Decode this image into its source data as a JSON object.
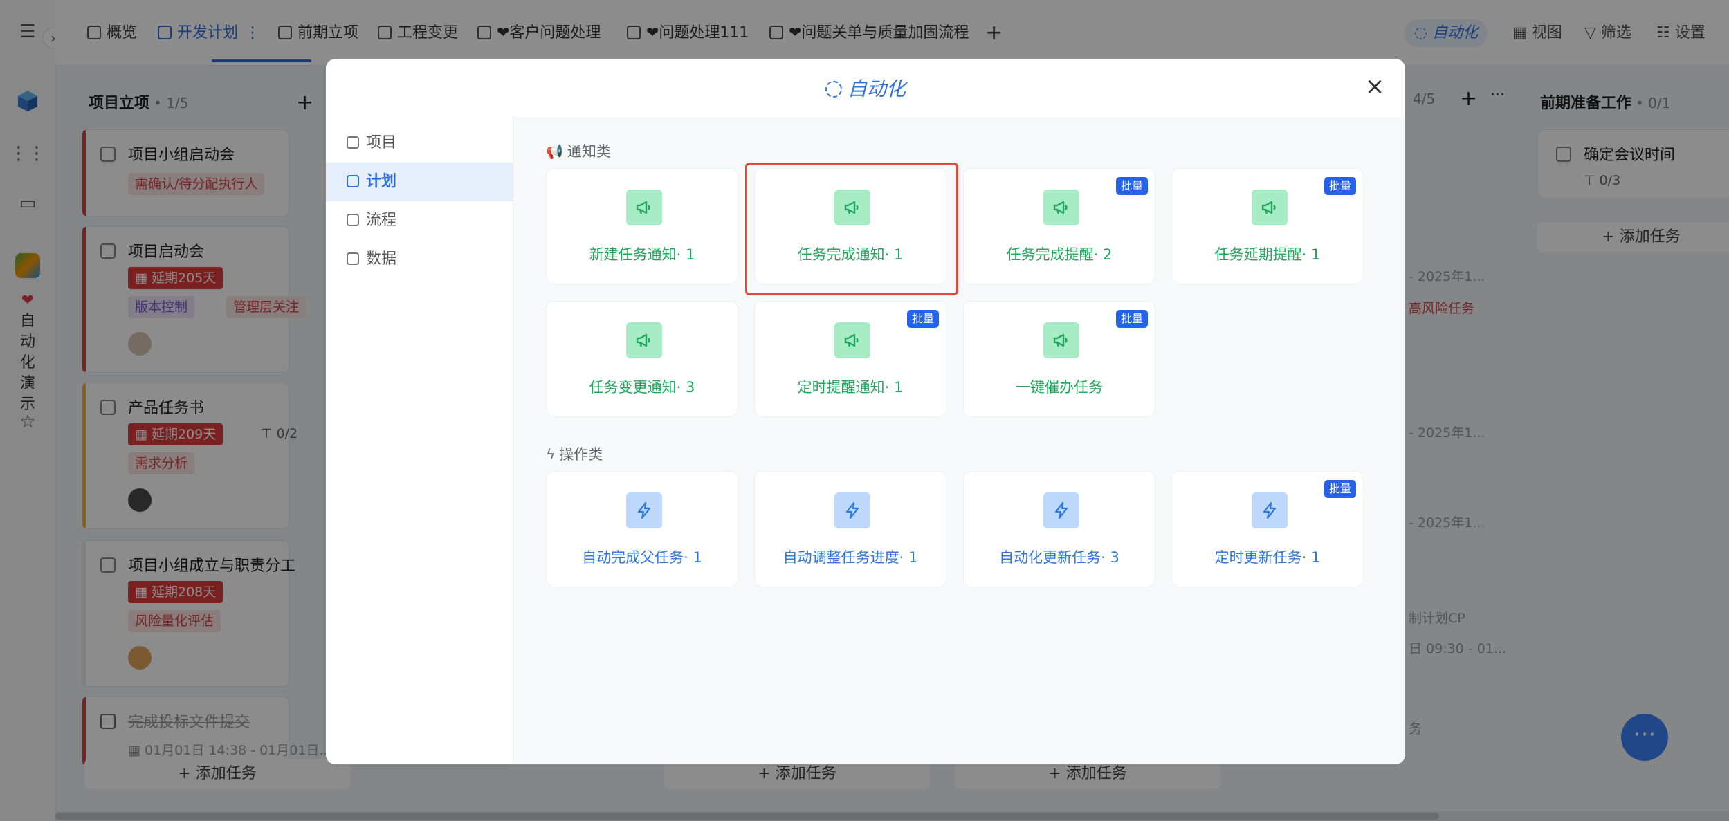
{
  "app": {
    "tabs": [
      {
        "label": "概览"
      },
      {
        "label": "开发计划"
      },
      {
        "label": "前期立项"
      },
      {
        "label": "工程变更"
      },
      {
        "label": "❤客户问题处理"
      },
      {
        "label": "❤问题处理111"
      },
      {
        "label": "❤问题关单与质量加固流程"
      }
    ],
    "add_tab": "+",
    "top_right": {
      "automation": "自动化",
      "view": "视图",
      "filter": "筛选",
      "settings": "设置"
    },
    "rail_vertical_text": "自动化演示",
    "columns": [
      {
        "title": "项目立项",
        "count": "• 1/5"
      },
      {
        "title": "前期准备工作",
        "count": "• 0/1"
      }
    ],
    "mid_count": "4/5",
    "cards": [
      {
        "title": "项目小组启动会",
        "tags": [
          "需确认/待分配执行人"
        ]
      },
      {
        "title": "项目启动会",
        "delay": "延期205天",
        "tags": [
          "版本控制",
          "管理层关注"
        ]
      },
      {
        "title": "产品任务书",
        "delay": "延期209天",
        "subtasks": "0/2",
        "tags": [
          "需求分析"
        ]
      },
      {
        "title": "项目小组成立与职责分工",
        "delay": "延期208天",
        "tags": [
          "风险量化评估"
        ]
      },
      {
        "title": "完成投标文件提交",
        "date": "01月01日 14:38 - 01月01日..."
      }
    ],
    "right_card": {
      "title": "确定会议时间",
      "subtasks": "0/3"
    },
    "add_task": "添加任务",
    "faint_texts": [
      "- 2025年1...",
      "高风险任务",
      "- 2025年1...",
      "- 2025年1...",
      "制计划CP",
      "日 09:30 - 01...",
      "务"
    ]
  },
  "modal": {
    "title": "自动化",
    "sidebar": [
      {
        "label": "项目"
      },
      {
        "label": "计划"
      },
      {
        "label": "流程"
      },
      {
        "label": "数据"
      }
    ],
    "sections": {
      "notify": "通知类",
      "operate": "操作类"
    },
    "badge_label": "批量",
    "notify_cards": [
      {
        "label": "新建任务通知· 1"
      },
      {
        "label": "任务完成通知· 1"
      },
      {
        "label": "任务完成提醒· 2"
      },
      {
        "label": "任务延期提醒· 1"
      },
      {
        "label": "任务变更通知· 3"
      },
      {
        "label": "定时提醒通知· 1"
      },
      {
        "label": "一键催办任务"
      }
    ],
    "operate_cards": [
      {
        "label": "自动完成父任务· 1"
      },
      {
        "label": "自动调整任务进度· 1"
      },
      {
        "label": "自动化更新任务· 3"
      },
      {
        "label": "定时更新任务· 1"
      }
    ]
  }
}
